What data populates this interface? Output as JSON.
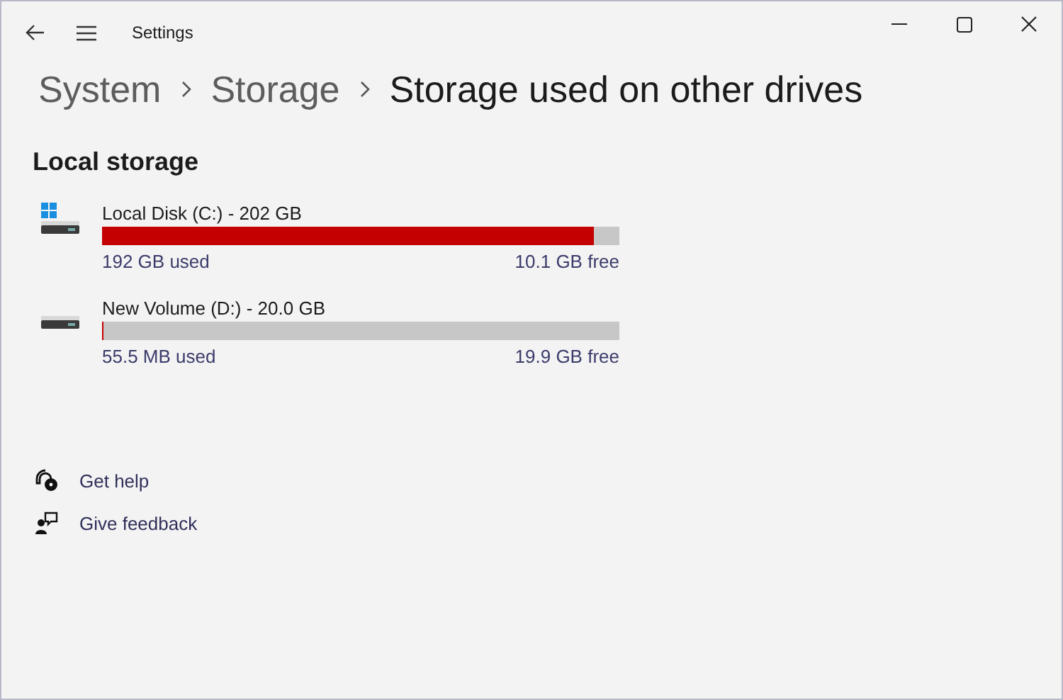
{
  "window": {
    "title": "Settings"
  },
  "breadcrumb": [
    {
      "label": "System",
      "current": false
    },
    {
      "label": "Storage",
      "current": false
    },
    {
      "label": "Storage used on other drives",
      "current": true
    }
  ],
  "section": {
    "title": "Local storage"
  },
  "drives": [
    {
      "name": "Local Disk (C:) - 202 GB",
      "system": true,
      "level": 0.95,
      "used": "192 GB used",
      "free": "10.1 GB free"
    },
    {
      "name": "New Volume (D:) - 20.0 GB",
      "system": false,
      "level": 0.003,
      "used": "55.5 MB used",
      "free": "19.9 GB free"
    }
  ],
  "links": [
    {
      "kind": "help",
      "label": "Get help"
    },
    {
      "kind": "feedback",
      "label": "Give feedback"
    }
  ]
}
